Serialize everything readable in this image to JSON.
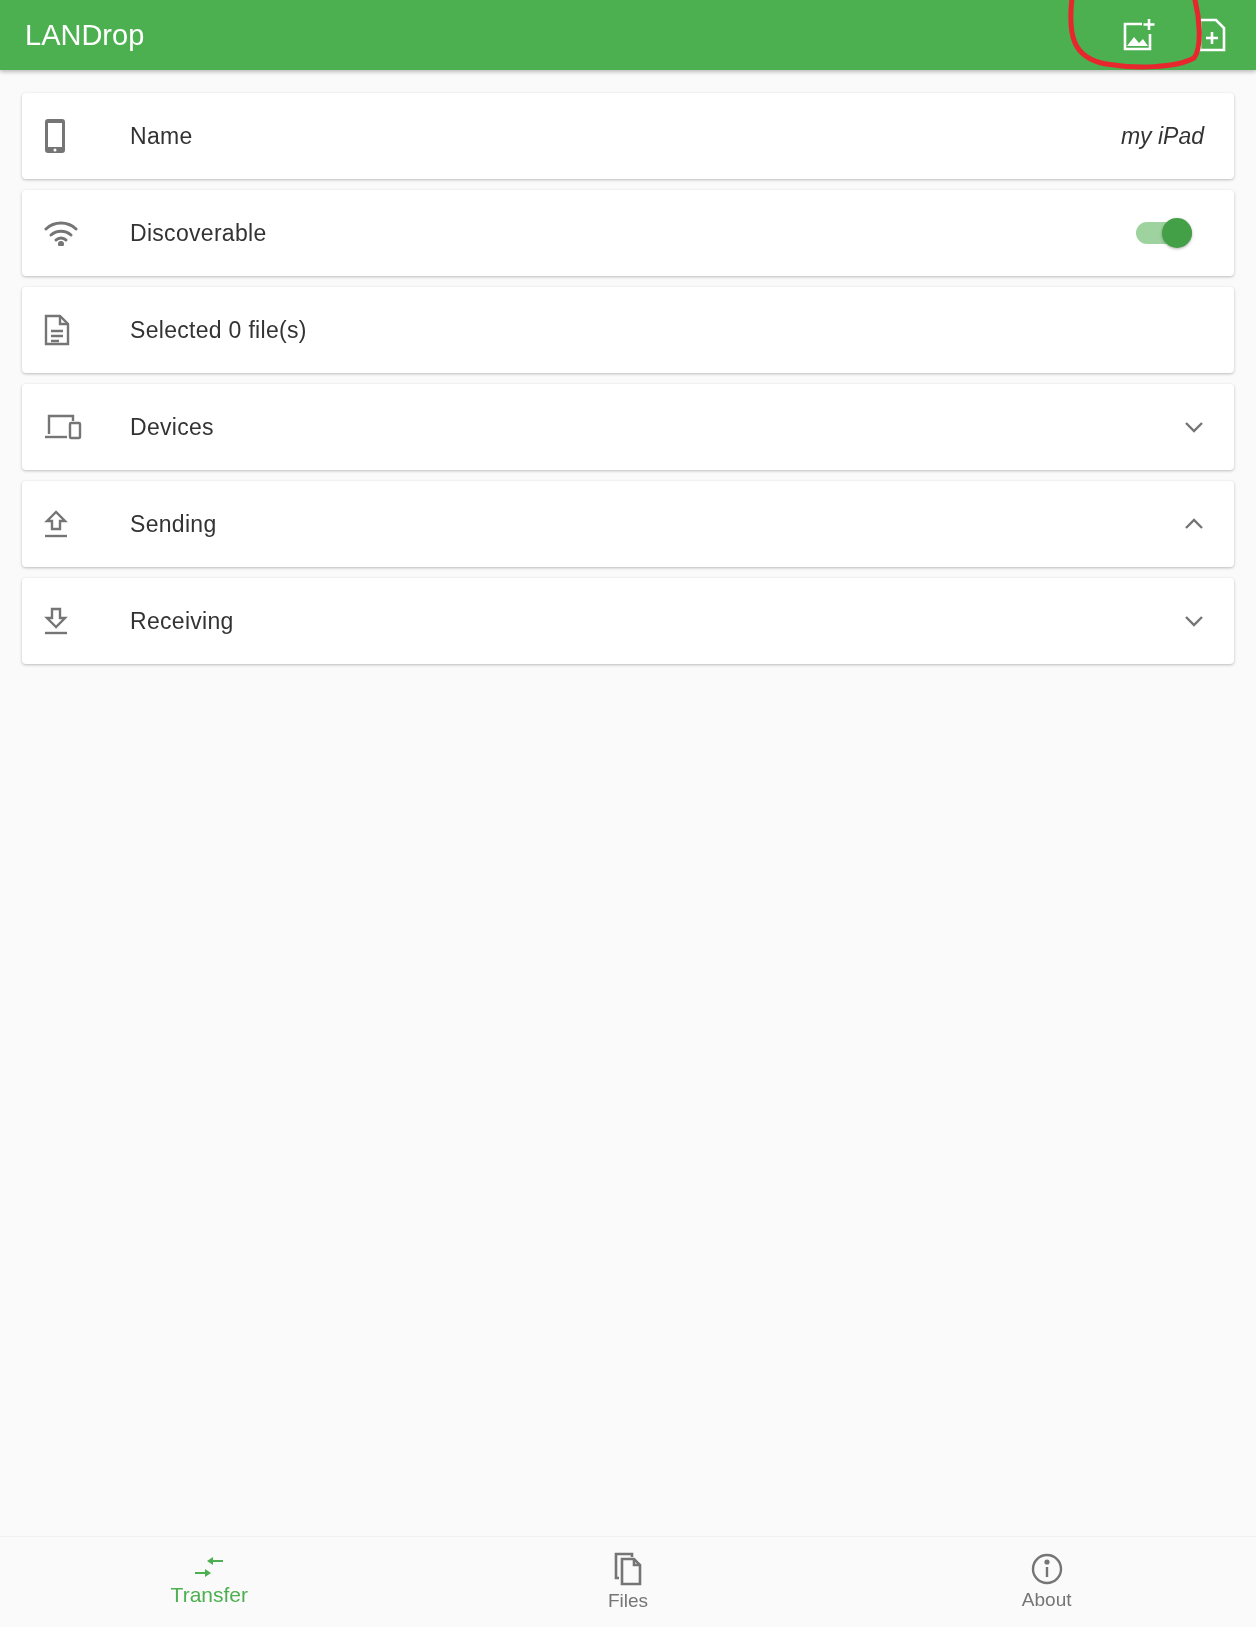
{
  "app_bar": {
    "title": "LANDrop"
  },
  "rows": [
    {
      "kind": "value",
      "label": "Name",
      "value": "my iPad"
    },
    {
      "kind": "switch",
      "label": "Discoverable",
      "on": true
    },
    {
      "kind": "plain",
      "label": "Selected 0 file(s)"
    },
    {
      "kind": "expandable",
      "label": "Devices",
      "expanded": false
    },
    {
      "kind": "expandable",
      "label": "Sending",
      "expanded": true
    },
    {
      "kind": "expandable",
      "label": "Receiving",
      "expanded": false
    }
  ],
  "bottom_nav": [
    {
      "label": "Transfer",
      "selected": true
    },
    {
      "label": "Files",
      "selected": false
    },
    {
      "label": "About",
      "selected": false
    }
  ]
}
